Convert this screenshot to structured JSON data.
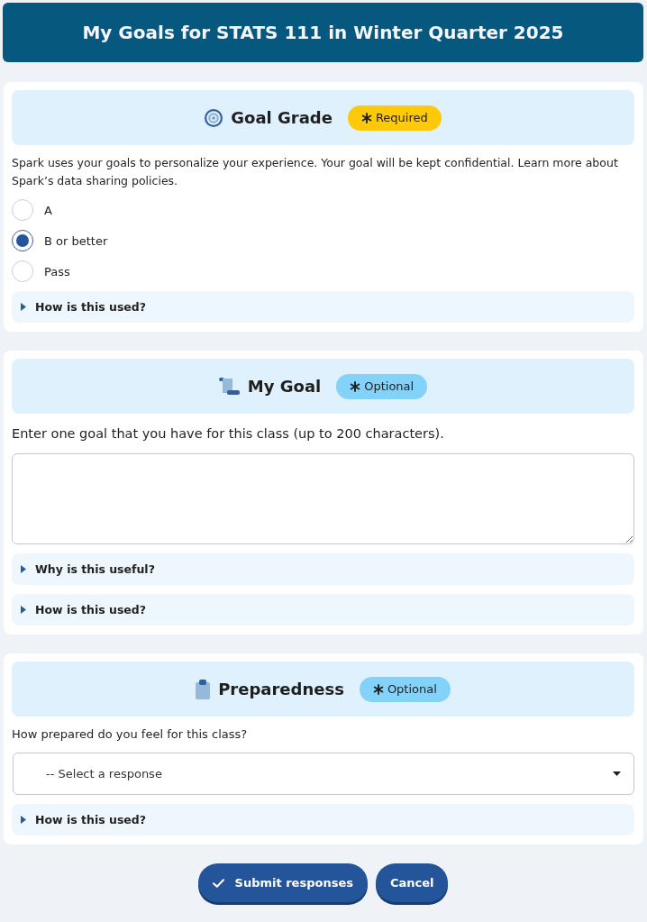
{
  "header": {
    "title": "My Goals for STATS 111 in Winter Quarter 2025"
  },
  "sections": [
    {
      "kind": "radio",
      "title": "Goal Grade",
      "badge": {
        "kind": "required",
        "label": "Required"
      },
      "description": "Spark uses your goals to personalize your experience. Your goal will be kept confidential. Learn more about Spark’s data sharing policies.",
      "options": [
        {
          "label": "A",
          "selected": false
        },
        {
          "label": "B or better",
          "selected": true
        },
        {
          "label": "Pass",
          "selected": false
        }
      ],
      "disclosures": [
        {
          "label": "How is this used?",
          "expanded": false
        }
      ]
    },
    {
      "kind": "textarea",
      "title": "My Goal",
      "badge": {
        "kind": "optional",
        "label": "Optional"
      },
      "prompt": "Enter one goal that you have for this class (up to 200 characters).",
      "disclosures": [
        {
          "label": "Why is this useful?",
          "expanded": false
        },
        {
          "label": "How is this used?",
          "expanded": false
        }
      ]
    },
    {
      "kind": "select",
      "title": "Preparedness",
      "badge": {
        "kind": "optional",
        "label": "Optional"
      },
      "prompt": "How prepared do you feel for this class?",
      "select": {
        "value": "-- Select a response"
      },
      "disclosures": [
        {
          "label": "How is this used?",
          "expanded": false
        }
      ]
    }
  ],
  "buttons": [
    {
      "kind": "submit",
      "label": "Submit responses"
    },
    {
      "kind": "cancel",
      "label": "Cancel"
    }
  ]
}
